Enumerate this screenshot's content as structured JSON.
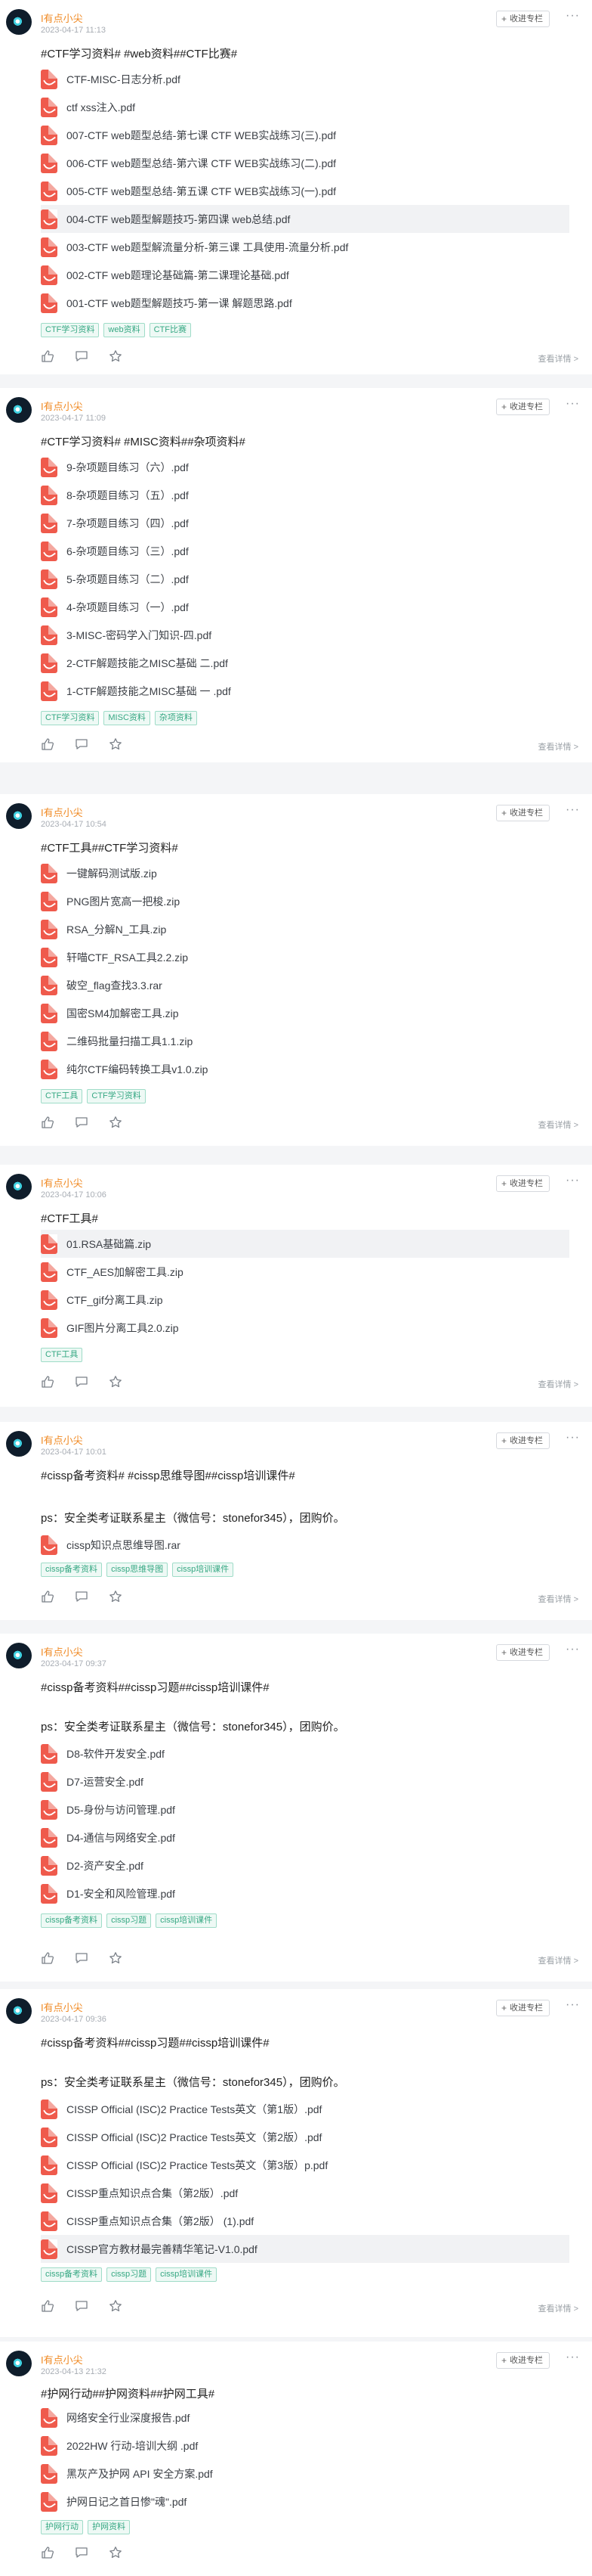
{
  "labels": {
    "follow": "收进专栏",
    "detail": "查看详情 >"
  },
  "colors": {
    "author": "#f08a24",
    "chip_text": "#36a883",
    "pdf_icon": "#ef5a4c",
    "background": "#f4f5f7"
  },
  "posts": [
    {
      "author": "I有点小尖",
      "date": "2023-04-17 11:13",
      "tags_line": "#CTF学习资料# #web资料##CTF比赛#",
      "note": "",
      "files": [
        "CTF-MISC-日志分析.pdf",
        "ctf xss注入.pdf",
        "007-CTF web题型总结-第七课 CTF WEB实战练习(三).pdf",
        "006-CTF web题型总结-第六课 CTF WEB实战练习(二).pdf",
        "005-CTF web题型总结-第五课 CTF WEB实战练习(一).pdf",
        "004-CTF web题型解题技巧-第四课 web总结.pdf",
        "003-CTF web题型解流量分析-第三课 工具使用-流量分析.pdf",
        "002-CTF web题理论基础篇-第二课理论基础.pdf",
        "001-CTF web题型解题技巧-第一课 解题思路.pdf"
      ],
      "chips": [
        "CTF学习资料",
        "web资料",
        "CTF比赛"
      ]
    },
    {
      "author": "I有点小尖",
      "date": "2023-04-17 11:09",
      "tags_line": "#CTF学习资料# #MISC资料##杂项资料#",
      "note": "",
      "files": [
        "9-杂项题目练习（六）.pdf",
        "8-杂项题目练习（五）.pdf",
        "7-杂项题目练习（四）.pdf",
        "6-杂项题目练习（三）.pdf",
        "5-杂项题目练习（二）.pdf",
        "4-杂项题目练习（一）.pdf",
        "3-MISC-密码学入门知识-四.pdf",
        "2-CTF解题技能之MISC基础 二.pdf",
        "1-CTF解题技能之MISC基础 一 .pdf"
      ],
      "chips": [
        "CTF学习资料",
        "MISC资料",
        "杂项资料"
      ]
    },
    {
      "author": "I有点小尖",
      "date": "2023-04-17 10:54",
      "tags_line": "#CTF工具##CTF学习资料#",
      "note": "",
      "files": [
        "一键解码测试版.zip",
        "PNG图片宽高一把梭.zip",
        "RSA_分解N_工具.zip",
        "轩喵CTF_RSA工具2.2.zip",
        "破空_flag查找3.3.rar",
        "国密SM4加解密工具.zip",
        "二维码批量扫描工具1.1.zip",
        "纯尔CTF编码转换工具v1.0.zip"
      ],
      "chips": [
        "CTF工具",
        "CTF学习资料"
      ]
    },
    {
      "author": "I有点小尖",
      "date": "2023-04-17 10:06",
      "tags_line": "#CTF工具#",
      "note": "",
      "files": [
        "01.RSA基础篇.zip",
        "CTF_AES加解密工具.zip",
        "CTF_gif分离工具.zip",
        "GIF图片分离工具2.0.zip"
      ],
      "chips": [
        "CTF工具"
      ]
    },
    {
      "author": "I有点小尖",
      "date": "2023-04-17 10:01",
      "tags_line": "#cissp备考资料# #cissp思维导图##cissp培训课件#",
      "note": "ps：安全类考证联系星主（微信号：stonefor345），团购价。",
      "files": [
        "cissp知识点思维导图.rar"
      ],
      "chips": [
        "cissp备考资料",
        "cissp思维导图",
        "cissp培训课件"
      ]
    },
    {
      "author": "I有点小尖",
      "date": "2023-04-17 09:37",
      "tags_line": "#cissp备考资料##cissp习题##cissp培训课件#",
      "note": "ps：安全类考证联系星主（微信号：stonefor345），团购价。",
      "files": [
        "D8-软件开发安全.pdf",
        "D7-运营安全.pdf",
        "D5-身份与访问管理.pdf",
        "D4-通信与网络安全.pdf",
        "D2-资产安全.pdf",
        "D1-安全和风险管理.pdf"
      ],
      "chips": [
        "cissp备考资料",
        "cissp习题",
        "cissp培训课件"
      ]
    },
    {
      "author": "I有点小尖",
      "date": "2023-04-17 09:36",
      "tags_line": "#cissp备考资料##cissp习题##cissp培训课件#",
      "note": "ps：安全类考证联系星主（微信号：stonefor345），团购价。",
      "files": [
        "CISSP Official (ISC)2 Practice Tests英文（第1版）.pdf",
        "CISSP Official (ISC)2 Practice Tests英文（第2版）.pdf",
        "CISSP Official (ISC)2 Practice Tests英文（第3版）p.pdf",
        "CISSP重点知识点合集（第2版）.pdf",
        "CISSP重点知识点合集（第2版） (1).pdf",
        "CISSP官方教材最完善精华笔记-V1.0.pdf"
      ],
      "chips": [
        "cissp备考资料",
        "cissp习题",
        "cissp培训课件"
      ]
    },
    {
      "author": "I有点小尖",
      "date": "2023-04-13 21:32",
      "tags_line": "#护网行动##护网资料##护网工具#",
      "note": "",
      "files": [
        "网络安全行业深度报告.pdf",
        "2022HW 行动-培训大纲 .pdf",
        "黑灰产及护网 API 安全方案.pdf",
        "护网日记之首日惨\"魂\".pdf"
      ],
      "chips": [
        "护网行动",
        "护网资料"
      ]
    }
  ]
}
